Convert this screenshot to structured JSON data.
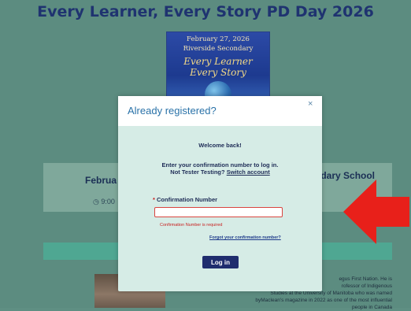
{
  "page": {
    "title": "Every Learner, Every Story PD Day 2026",
    "poster": {
      "date": "February 27, 2026",
      "school": "Riverside Secondary",
      "art_line1": "Every Learner",
      "art_line2": "Every Story"
    },
    "event": {
      "left_text": "Februa",
      "right_text": "ndary School",
      "time_text": "◷ 9:00"
    },
    "bio": {
      "line1": "egus First Nation. He is",
      "line2": "rofessor of Indigenous",
      "line3": "Studies at the University of Manitoba who was named",
      "line4": "byMaclean's magazine in 2022 as one of the most influential",
      "line5": "people in Canada"
    }
  },
  "modal": {
    "title": "Already registered?",
    "close_icon": "×",
    "welcome": "Welcome back!",
    "instruction": "Enter your confirmation number to log in.",
    "not_user_prefix": "Not Tester Testing?",
    "switch_account": "Switch account",
    "required_marker": "*",
    "field_label": "Confirmation Number",
    "field_value": "",
    "error": "Confirmation Number is required",
    "forgot_link": "Forgot your confirmation number?",
    "login_button": "Log in"
  },
  "colors": {
    "overlay_background": "#5c8c80",
    "modal_body": "#d6ece6",
    "title_blue": "#1f3370",
    "modal_title": "#2a72a8",
    "error_red": "#c81e1e",
    "login_button": "#1f2d6e",
    "annotation_arrow": "#e8201a"
  },
  "icons": {
    "close": "close-icon",
    "arrow": "red-arrow-annotation"
  }
}
